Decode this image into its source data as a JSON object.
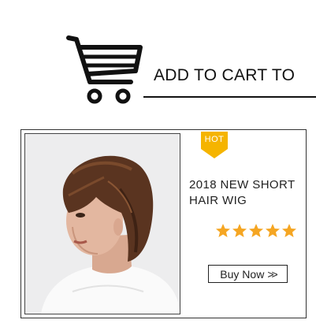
{
  "header": {
    "title": "ADD TO CART TO",
    "icon": "shopping-cart-icon"
  },
  "product": {
    "badge": "HOT",
    "title": "2018 NEW SHORT HAIR WIG",
    "rating": 5,
    "rating_max": 5,
    "buy_button_label": "Buy Now",
    "buy_button_icon": "double-chevron-right-icon"
  },
  "colors": {
    "badge": "#f5b400",
    "stars": "#f5a623",
    "text": "#111111"
  }
}
